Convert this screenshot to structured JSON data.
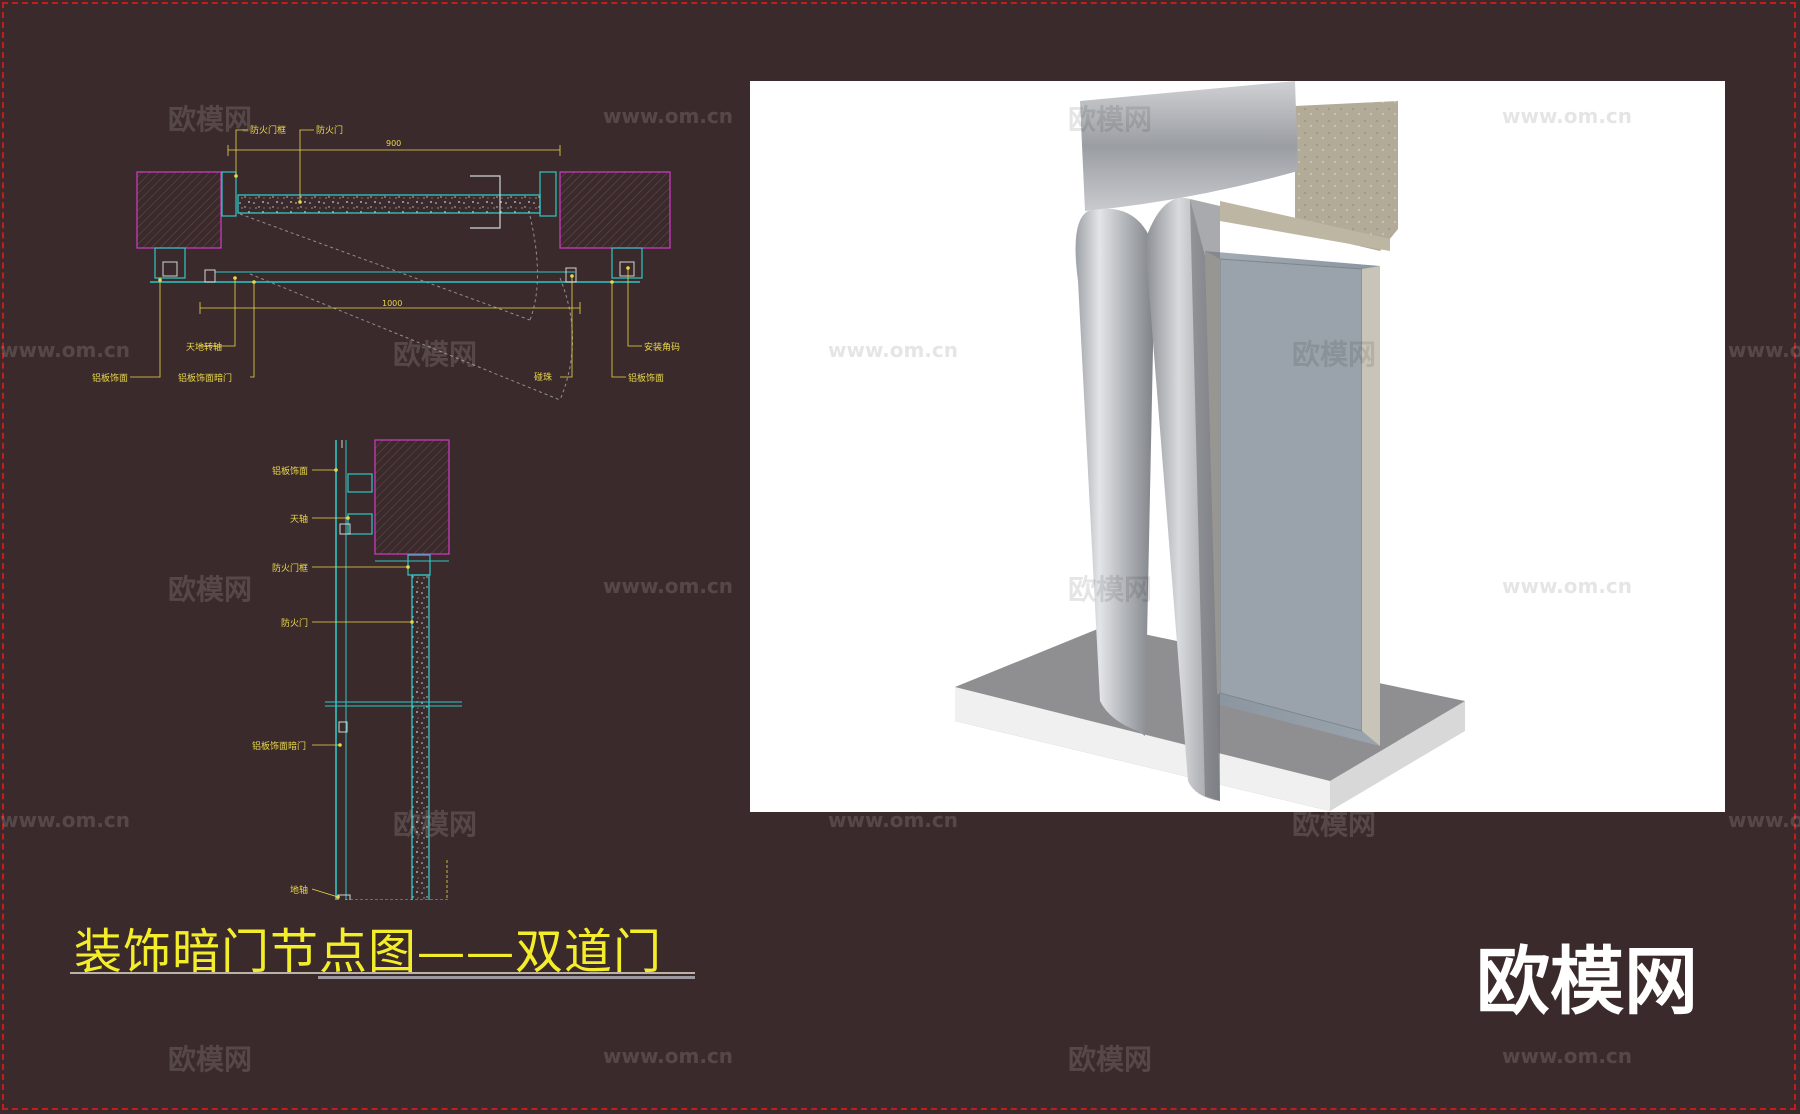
{
  "title": "装饰暗门节点图——双道门",
  "brand_logo": "欧模网",
  "watermarks": {
    "cn": "欧模网",
    "url": "www.om.cn"
  },
  "plan_view": {
    "labels": {
      "fire_door_frame": "防火门框",
      "fire_door": "防火门",
      "ceiling_floor_pivot": "天地转轴",
      "aluminum_panel_finish_left": "铝板饰面",
      "aluminum_panel_hidden_door": "铝板饰面暗门",
      "door_stop": "碰珠",
      "mounting_bracket": "安装角码",
      "aluminum_panel_finish_right": "铝板饰面"
    },
    "dimensions": {
      "top": "900",
      "bottom": "1000"
    }
  },
  "section_view": {
    "labels": {
      "aluminum_panel_finish": "铝板饰面",
      "top_pivot": "天轴",
      "fire_door_frame": "防火门框",
      "fire_door": "防火门",
      "aluminum_panel_hidden_door": "铝板饰面暗门",
      "floor_pivot": "地轴"
    }
  },
  "colors": {
    "background": "#3b2a2b",
    "cad_cyan": "#2fc6c6",
    "cad_magenta": "#d23cc8",
    "cad_yellow": "#e8d84a",
    "title_yellow": "#f4ee2a",
    "dashed_border": "#c21d1d"
  }
}
